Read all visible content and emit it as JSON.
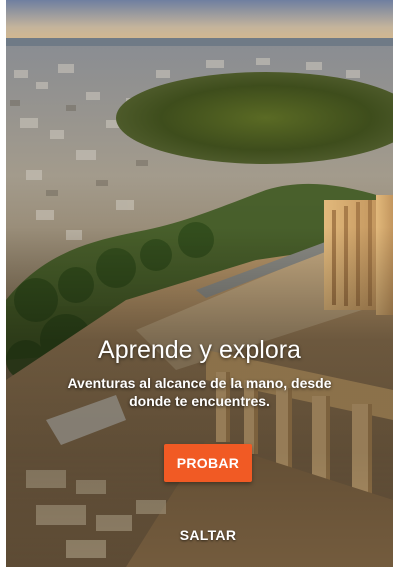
{
  "onboarding": {
    "headline": "Aprende y explora",
    "subtitle": "Aventuras al alcance de la mano, desde donde te encuentres.",
    "primary_button_label": "PROBAR",
    "skip_button_label": "SALTAR",
    "background_image": "aerial-view-acropolis-athens"
  },
  "colors": {
    "accent": "#f15a24",
    "text": "#ffffff"
  }
}
